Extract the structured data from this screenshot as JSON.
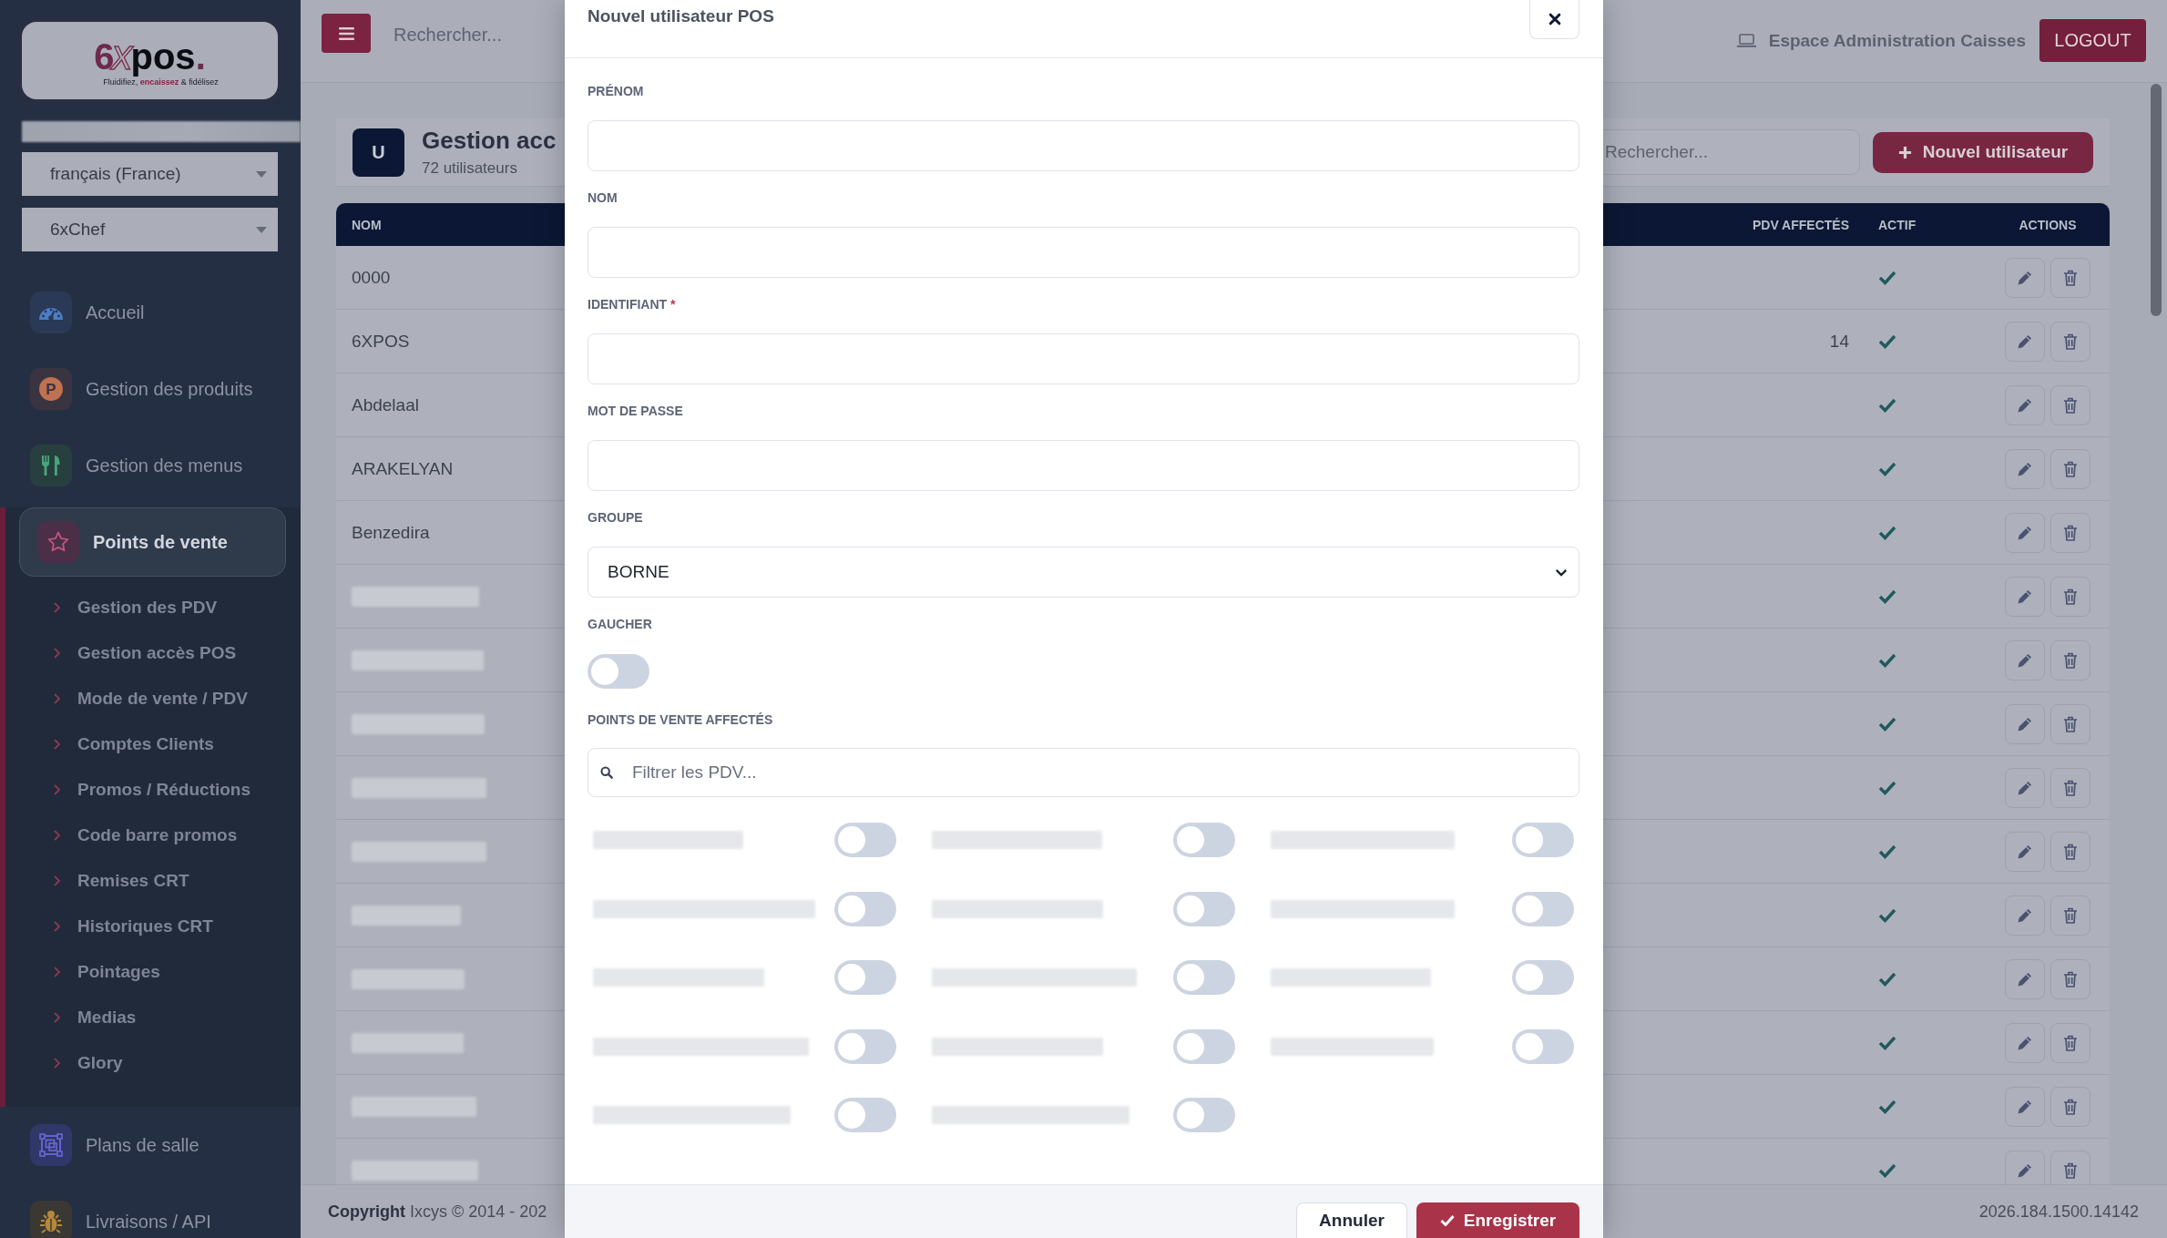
{
  "sidebar": {
    "logo": {
      "parts": [
        {
          "text": "6",
          "kind": "accent"
        },
        {
          "text": "x",
          "kind": "outline"
        },
        {
          "text": "pos",
          "kind": "dark"
        },
        {
          "text": ".",
          "kind": "accent"
        }
      ],
      "tagline": "Fluidifiez, **encaissez** & fidélisez"
    },
    "redacted_strip": true,
    "selects": [
      {
        "value": "français (France)"
      },
      {
        "value": "6xChef"
      }
    ],
    "nav": [
      {
        "label": "Accueil",
        "selected": false
      },
      {
        "label": "Gestion des produits",
        "icon_letter": "P",
        "selected": false
      },
      {
        "label": "Gestion des menus",
        "selected": false
      },
      {
        "label": "Points de vente",
        "selected": true,
        "expanded": true,
        "children": [
          {
            "label": "Gestion des PDV",
            "selected": false
          },
          {
            "label": "Gestion accès POS",
            "selected": false
          },
          {
            "label": "Mode de vente / PDV",
            "selected": false
          },
          {
            "label": "Comptes Clients",
            "selected": false
          },
          {
            "label": "Promos / Réductions",
            "selected": false
          },
          {
            "label": "Code barre promos",
            "selected": false
          },
          {
            "label": "Remises CRT",
            "selected": false
          },
          {
            "label": "Historiques CRT",
            "selected": false
          },
          {
            "label": "Pointages",
            "selected": false
          },
          {
            "label": "Medias",
            "selected": false
          },
          {
            "label": "Glory",
            "selected": false
          }
        ]
      },
      {
        "label": "Plans de salle",
        "selected": false
      },
      {
        "label": "Livraisons / API",
        "selected": false
      }
    ]
  },
  "top_bar": {
    "search": {
      "placeholder": "Rechercher..."
    },
    "workspace": "Espace Administration Caisses",
    "logout": "LOGOUT"
  },
  "page_header": {
    "avatar": "U",
    "title": "Gestion acc",
    "subtitle": "72 utilisateurs",
    "search": {
      "placeholder": "Rechercher..."
    },
    "new_button": "Nouvel utilisateur"
  },
  "table": {
    "columns": [
      "NOM",
      "PDV AFFECTÉS",
      "ACTIF",
      "ACTIONS"
    ],
    "rows": [
      {
        "name": "0000",
        "active": true
      },
      {
        "name": "6XPOS",
        "pdv_count": "14",
        "active": true
      },
      {
        "name": "Abdelaal",
        "active": true
      },
      {
        "name": "ARAKELYAN",
        "active": true
      },
      {
        "name": "Benzedira",
        "active": true
      },
      {
        "name_redacted": true,
        "active": true
      },
      {
        "name_redacted": true,
        "active": true
      },
      {
        "name_redacted": true,
        "active": true
      },
      {
        "name_redacted": true,
        "active": true
      },
      {
        "name_redacted": true,
        "active": true
      },
      {
        "name_redacted": true,
        "active": true
      },
      {
        "name_redacted": true,
        "active": true
      },
      {
        "name_redacted": true,
        "active": true
      },
      {
        "name_redacted": true,
        "active": true
      },
      {
        "name_redacted": true,
        "active": true
      }
    ]
  },
  "footer": {
    "copyright": "**Copyright** Ixcys © 2014 - 202",
    "version": "2026.184.1500.14142"
  },
  "modal": {
    "title": "Nouvel utilisateur POS",
    "fields": [
      {
        "label": "PRÉNOM",
        "kind": "text"
      },
      {
        "label": "NOM",
        "kind": "text"
      },
      {
        "label": "IDENTIFIANT",
        "required_mark": "*",
        "kind": "text"
      },
      {
        "label": "MOT DE PASSE",
        "kind": "password"
      },
      {
        "label": "GROUPE",
        "kind": "select",
        "value": "BORNE"
      },
      {
        "label": "GAUCHER",
        "kind": "switch",
        "on": false
      },
      {
        "label": "POINTS DE VENTE AFFECTÉS",
        "kind": "pdv_list",
        "filter": {
          "placeholder": "Filtrer les PDV..."
        },
        "switches": [
          {
            "label_redacted": true,
            "on": false
          },
          {
            "label_redacted": true,
            "on": false
          },
          {
            "label_redacted": true,
            "on": false
          },
          {
            "label_redacted": true,
            "on": false
          },
          {
            "label_redacted": true,
            "on": false
          },
          {
            "label_redacted": true,
            "on": false
          },
          {
            "label_redacted": true,
            "on": false
          },
          {
            "label_redacted": true,
            "on": false
          },
          {
            "label_redacted": true,
            "on": false
          },
          {
            "label_redacted": true,
            "on": false
          },
          {
            "label_redacted": true,
            "on": false
          },
          {
            "label_redacted": true,
            "on": false
          },
          {
            "label_redacted": true,
            "on": false
          },
          {
            "label_redacted": true,
            "on": false
          }
        ]
      }
    ],
    "buttons": [
      {
        "label": "Annuler",
        "kind": "secondary"
      },
      {
        "label": "Enregistrer",
        "kind": "primary"
      }
    ]
  }
}
